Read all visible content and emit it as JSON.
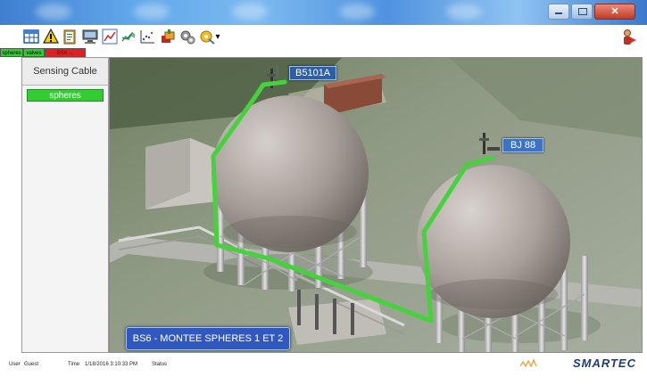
{
  "window": {
    "close_label": "✕"
  },
  "toolbar": {
    "icons": [
      "grid-icon",
      "warning-icon",
      "clipboard-icon",
      "monitor-icon",
      "chart-line-icon",
      "chart-spark-icon",
      "chart-scatter-icon",
      "tools-icon",
      "gears-icon",
      "settings-icon",
      "exit-icon"
    ]
  },
  "tabs": [
    {
      "label": "spheres",
      "color": "#33cc33"
    },
    {
      "label": "valves",
      "color": "#33cc33"
    },
    {
      "label": "BS6 ...",
      "color": "#e02020"
    }
  ],
  "sidebar": {
    "title": "Sensing Cable",
    "items": [
      {
        "label": "spheres"
      }
    ]
  },
  "scene": {
    "tags": [
      {
        "label": "B5101A"
      },
      {
        "label": "BJ 88"
      }
    ],
    "caption": "BS6 - MONTEE SPHERES 1 ET 2"
  },
  "status": {
    "user_label": "User",
    "user_value": "Guest",
    "time_label": "Time",
    "time_value": "1/18/2016 3:10:33 PM",
    "status_label": "Status"
  },
  "brand": {
    "name": "SMARTEC",
    "accent": "#f0a030",
    "primary": "#1c3e74"
  }
}
